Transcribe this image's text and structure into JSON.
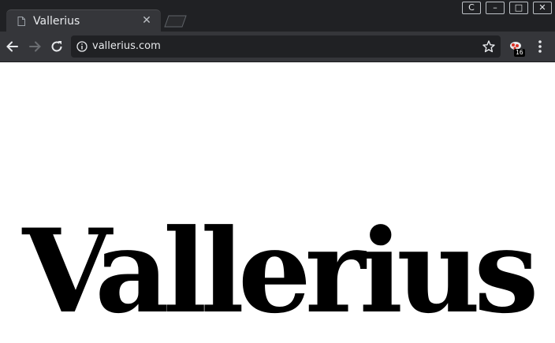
{
  "browser": {
    "tab": {
      "title": "Vallerius",
      "close_glyph": "✕",
      "icon": "page-icon"
    },
    "window_controls": [
      {
        "name": "window-c-button",
        "glyph": "C"
      },
      {
        "name": "window-minimize-button",
        "glyph": "–"
      },
      {
        "name": "window-maximize-button",
        "glyph": "□"
      },
      {
        "name": "window-close-button",
        "glyph": "✕"
      }
    ],
    "toolbar": {
      "back_icon": "arrow-left-icon",
      "forward_icon": "arrow-right-icon",
      "reload_icon": "reload-icon",
      "url": "vallerius.com",
      "security_icon": "info-icon",
      "bookmark_icon": "star-icon",
      "extension_badge": "16",
      "menu_icon": "kebab-menu-icon"
    }
  },
  "page": {
    "headline": "Vallerius"
  },
  "colors": {
    "titlebar_bg": "#202124",
    "toolbar_bg": "#35363a",
    "omnibox_bg": "#202124",
    "text_light": "#e8eaed",
    "page_bg": "#ffffff",
    "headline_color": "#000000"
  }
}
